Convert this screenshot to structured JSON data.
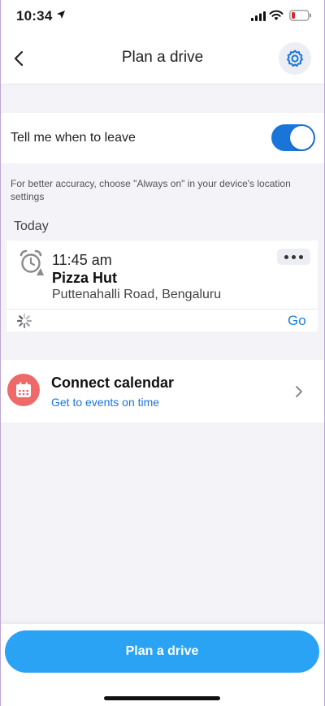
{
  "status": {
    "time": "10:34"
  },
  "nav": {
    "title": "Plan a drive"
  },
  "leave": {
    "label": "Tell me when to leave",
    "enabled": true
  },
  "hint": "For better accuracy, choose \"Always on\" in your device's location settings",
  "section": {
    "today": "Today"
  },
  "trip": {
    "time": "11:45 am",
    "place": "Pizza Hut",
    "address": "Puttenahalli Road, Bengaluru",
    "go_label": "Go"
  },
  "calendar": {
    "title": "Connect calendar",
    "subtitle": "Get to events on time"
  },
  "footer": {
    "plan_button": "Plan a drive"
  },
  "colors": {
    "accent": "#1a75d9",
    "button": "#2aa3f5",
    "calendar_icon_bg": "#ee6a6a"
  }
}
